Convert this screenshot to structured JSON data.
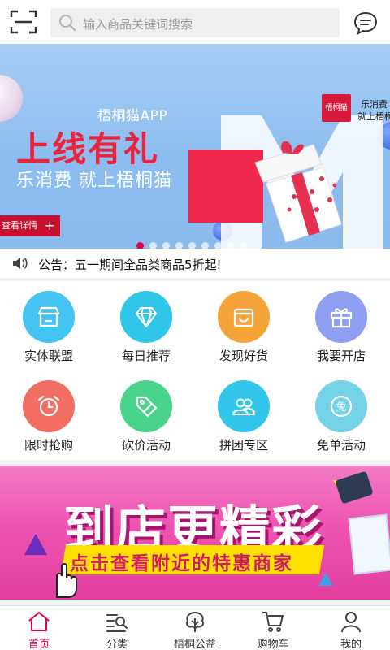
{
  "header": {
    "search_placeholder": "输入商品关键词搜索"
  },
  "banner": {
    "app_name": "梧桐猫APP",
    "title": "上线有礼",
    "subtitle": "乐消费 就上梧桐猫",
    "button_label": "查看详情",
    "logo_text": "梧桐猫",
    "slogan_line1": "乐消费",
    "slogan_line2": "就上梧桐猫",
    "dots_total": 9,
    "active_dot": 1
  },
  "notice": {
    "text": "公告：五一期间全品类商品5折起!"
  },
  "grid": [
    {
      "label": "实体联盟",
      "icon": "store-icon",
      "color": "#45c3f2"
    },
    {
      "label": "每日推荐",
      "icon": "diamond-icon",
      "color": "#30c6ea"
    },
    {
      "label": "发现好货",
      "icon": "bag-icon",
      "color": "#f5a43a"
    },
    {
      "label": "我要开店",
      "icon": "gift-icon",
      "color": "#8e9ef0"
    },
    {
      "label": "限时抢购",
      "icon": "alarm-clock-icon",
      "color": "#f26d62"
    },
    {
      "label": "砍价活动",
      "icon": "price-tag-icon",
      "color": "#4ad38a"
    },
    {
      "label": "拼团专区",
      "icon": "group-icon",
      "color": "#32c6ea"
    },
    {
      "label": "免单活动",
      "icon": "free-icon",
      "color": "#74d3e6"
    }
  ],
  "ad": {
    "title": "到店更精彩",
    "subtitle": "点击查看附近的特惠商家"
  },
  "tabbar": [
    {
      "label": "首页",
      "icon": "home-icon",
      "active": true
    },
    {
      "label": "分类",
      "icon": "category-search-icon",
      "active": false
    },
    {
      "label": "梧桐公益",
      "icon": "tree-icon",
      "active": false
    },
    {
      "label": "购物车",
      "icon": "cart-icon",
      "active": false
    },
    {
      "label": "我的",
      "icon": "user-icon",
      "active": false
    }
  ],
  "colors": {
    "accent": "#e60050",
    "banner_red": "#e8243e"
  }
}
